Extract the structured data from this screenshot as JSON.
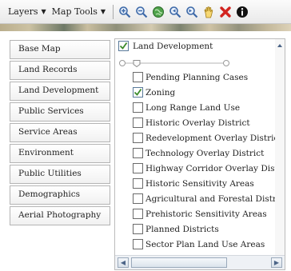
{
  "toolbar": {
    "layers_label": "Layers",
    "maptools_label": "Map Tools",
    "icons": [
      "zoom-in-icon",
      "zoom-out-icon",
      "full-extent-icon",
      "back-icon",
      "forward-icon",
      "pan-icon",
      "clear-icon",
      "identify-icon"
    ]
  },
  "left_tabs": [
    {
      "label": "Base Map"
    },
    {
      "label": "Land Records"
    },
    {
      "label": "Land Development"
    },
    {
      "label": "Public Services"
    },
    {
      "label": "Service Areas"
    },
    {
      "label": "Environment"
    },
    {
      "label": "Public Utilities"
    },
    {
      "label": "Demographics"
    },
    {
      "label": "Aerial Photography"
    }
  ],
  "panel": {
    "group_label": "Land Development",
    "group_checked": true,
    "layers": [
      {
        "label": "Pending Planning Cases",
        "checked": false
      },
      {
        "label": "Zoning",
        "checked": true
      },
      {
        "label": "Long Range Land Use",
        "checked": false
      },
      {
        "label": "Historic Overlay District",
        "checked": false
      },
      {
        "label": "Redevelopment Overlay Districts",
        "checked": false
      },
      {
        "label": "Technology Overlay District",
        "checked": false
      },
      {
        "label": "Highway Corridor Overlay District",
        "checked": false
      },
      {
        "label": "Historic Sensitivity Areas",
        "checked": false
      },
      {
        "label": "Agricultural and Forestal Districts",
        "checked": false
      },
      {
        "label": "Prehistoric Sensitivity Areas",
        "checked": false
      },
      {
        "label": "Planned Districts",
        "checked": false
      },
      {
        "label": "Sector Plan Land Use Areas",
        "checked": false
      }
    ]
  },
  "colors": {
    "checkmark": "#3b8a2a",
    "scroll_arrow": "#4b6487"
  }
}
